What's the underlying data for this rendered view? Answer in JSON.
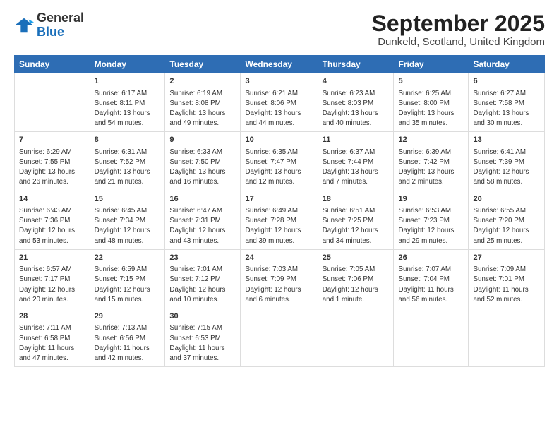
{
  "logo": {
    "general": "General",
    "blue": "Blue"
  },
  "header": {
    "title": "September 2025",
    "subtitle": "Dunkeld, Scotland, United Kingdom"
  },
  "days_of_week": [
    "Sunday",
    "Monday",
    "Tuesday",
    "Wednesday",
    "Thursday",
    "Friday",
    "Saturday"
  ],
  "weeks": [
    [
      {
        "day": "",
        "info": ""
      },
      {
        "day": "1",
        "info": "Sunrise: 6:17 AM\nSunset: 8:11 PM\nDaylight: 13 hours\nand 54 minutes."
      },
      {
        "day": "2",
        "info": "Sunrise: 6:19 AM\nSunset: 8:08 PM\nDaylight: 13 hours\nand 49 minutes."
      },
      {
        "day": "3",
        "info": "Sunrise: 6:21 AM\nSunset: 8:06 PM\nDaylight: 13 hours\nand 44 minutes."
      },
      {
        "day": "4",
        "info": "Sunrise: 6:23 AM\nSunset: 8:03 PM\nDaylight: 13 hours\nand 40 minutes."
      },
      {
        "day": "5",
        "info": "Sunrise: 6:25 AM\nSunset: 8:00 PM\nDaylight: 13 hours\nand 35 minutes."
      },
      {
        "day": "6",
        "info": "Sunrise: 6:27 AM\nSunset: 7:58 PM\nDaylight: 13 hours\nand 30 minutes."
      }
    ],
    [
      {
        "day": "7",
        "info": "Sunrise: 6:29 AM\nSunset: 7:55 PM\nDaylight: 13 hours\nand 26 minutes."
      },
      {
        "day": "8",
        "info": "Sunrise: 6:31 AM\nSunset: 7:52 PM\nDaylight: 13 hours\nand 21 minutes."
      },
      {
        "day": "9",
        "info": "Sunrise: 6:33 AM\nSunset: 7:50 PM\nDaylight: 13 hours\nand 16 minutes."
      },
      {
        "day": "10",
        "info": "Sunrise: 6:35 AM\nSunset: 7:47 PM\nDaylight: 13 hours\nand 12 minutes."
      },
      {
        "day": "11",
        "info": "Sunrise: 6:37 AM\nSunset: 7:44 PM\nDaylight: 13 hours\nand 7 minutes."
      },
      {
        "day": "12",
        "info": "Sunrise: 6:39 AM\nSunset: 7:42 PM\nDaylight: 13 hours\nand 2 minutes."
      },
      {
        "day": "13",
        "info": "Sunrise: 6:41 AM\nSunset: 7:39 PM\nDaylight: 12 hours\nand 58 minutes."
      }
    ],
    [
      {
        "day": "14",
        "info": "Sunrise: 6:43 AM\nSunset: 7:36 PM\nDaylight: 12 hours\nand 53 minutes."
      },
      {
        "day": "15",
        "info": "Sunrise: 6:45 AM\nSunset: 7:34 PM\nDaylight: 12 hours\nand 48 minutes."
      },
      {
        "day": "16",
        "info": "Sunrise: 6:47 AM\nSunset: 7:31 PM\nDaylight: 12 hours\nand 43 minutes."
      },
      {
        "day": "17",
        "info": "Sunrise: 6:49 AM\nSunset: 7:28 PM\nDaylight: 12 hours\nand 39 minutes."
      },
      {
        "day": "18",
        "info": "Sunrise: 6:51 AM\nSunset: 7:25 PM\nDaylight: 12 hours\nand 34 minutes."
      },
      {
        "day": "19",
        "info": "Sunrise: 6:53 AM\nSunset: 7:23 PM\nDaylight: 12 hours\nand 29 minutes."
      },
      {
        "day": "20",
        "info": "Sunrise: 6:55 AM\nSunset: 7:20 PM\nDaylight: 12 hours\nand 25 minutes."
      }
    ],
    [
      {
        "day": "21",
        "info": "Sunrise: 6:57 AM\nSunset: 7:17 PM\nDaylight: 12 hours\nand 20 minutes."
      },
      {
        "day": "22",
        "info": "Sunrise: 6:59 AM\nSunset: 7:15 PM\nDaylight: 12 hours\nand 15 minutes."
      },
      {
        "day": "23",
        "info": "Sunrise: 7:01 AM\nSunset: 7:12 PM\nDaylight: 12 hours\nand 10 minutes."
      },
      {
        "day": "24",
        "info": "Sunrise: 7:03 AM\nSunset: 7:09 PM\nDaylight: 12 hours\nand 6 minutes."
      },
      {
        "day": "25",
        "info": "Sunrise: 7:05 AM\nSunset: 7:06 PM\nDaylight: 12 hours\nand 1 minute."
      },
      {
        "day": "26",
        "info": "Sunrise: 7:07 AM\nSunset: 7:04 PM\nDaylight: 11 hours\nand 56 minutes."
      },
      {
        "day": "27",
        "info": "Sunrise: 7:09 AM\nSunset: 7:01 PM\nDaylight: 11 hours\nand 52 minutes."
      }
    ],
    [
      {
        "day": "28",
        "info": "Sunrise: 7:11 AM\nSunset: 6:58 PM\nDaylight: 11 hours\nand 47 minutes."
      },
      {
        "day": "29",
        "info": "Sunrise: 7:13 AM\nSunset: 6:56 PM\nDaylight: 11 hours\nand 42 minutes."
      },
      {
        "day": "30",
        "info": "Sunrise: 7:15 AM\nSunset: 6:53 PM\nDaylight: 11 hours\nand 37 minutes."
      },
      {
        "day": "",
        "info": ""
      },
      {
        "day": "",
        "info": ""
      },
      {
        "day": "",
        "info": ""
      },
      {
        "day": "",
        "info": ""
      }
    ]
  ]
}
